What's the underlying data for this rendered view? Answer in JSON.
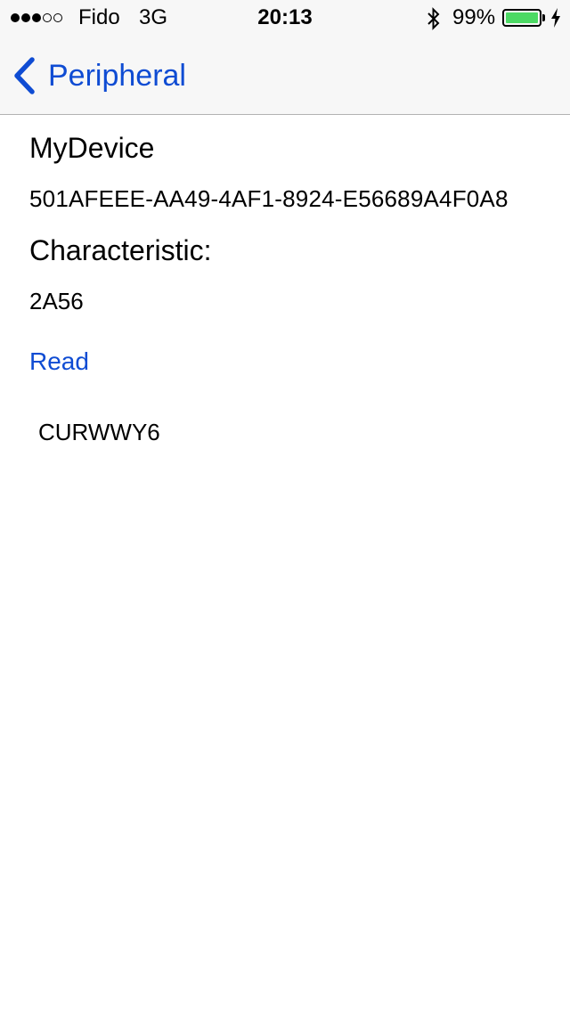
{
  "status_bar": {
    "carrier": "Fido",
    "network": "3G",
    "time": "20:13",
    "battery_percent": "99%",
    "battery_level": 0.99,
    "battery_color": "#4cd964",
    "signal_strength": 3,
    "signal_max": 5,
    "icons": [
      "signal-dots",
      "bluetooth-icon",
      "battery-icon",
      "charging-bolt-icon"
    ]
  },
  "nav": {
    "back_label": "Peripheral",
    "back_icon": "chevron-left-icon",
    "tint_color": "#0f4cd3"
  },
  "device": {
    "name": "MyDevice",
    "uuid": "501AFEEE-AA49-4AF1-8924-E56689A4F0A8"
  },
  "characteristic": {
    "title": "Characteristic:",
    "uuid": "2A56",
    "read_label": "Read",
    "value": "CURWWY6"
  }
}
